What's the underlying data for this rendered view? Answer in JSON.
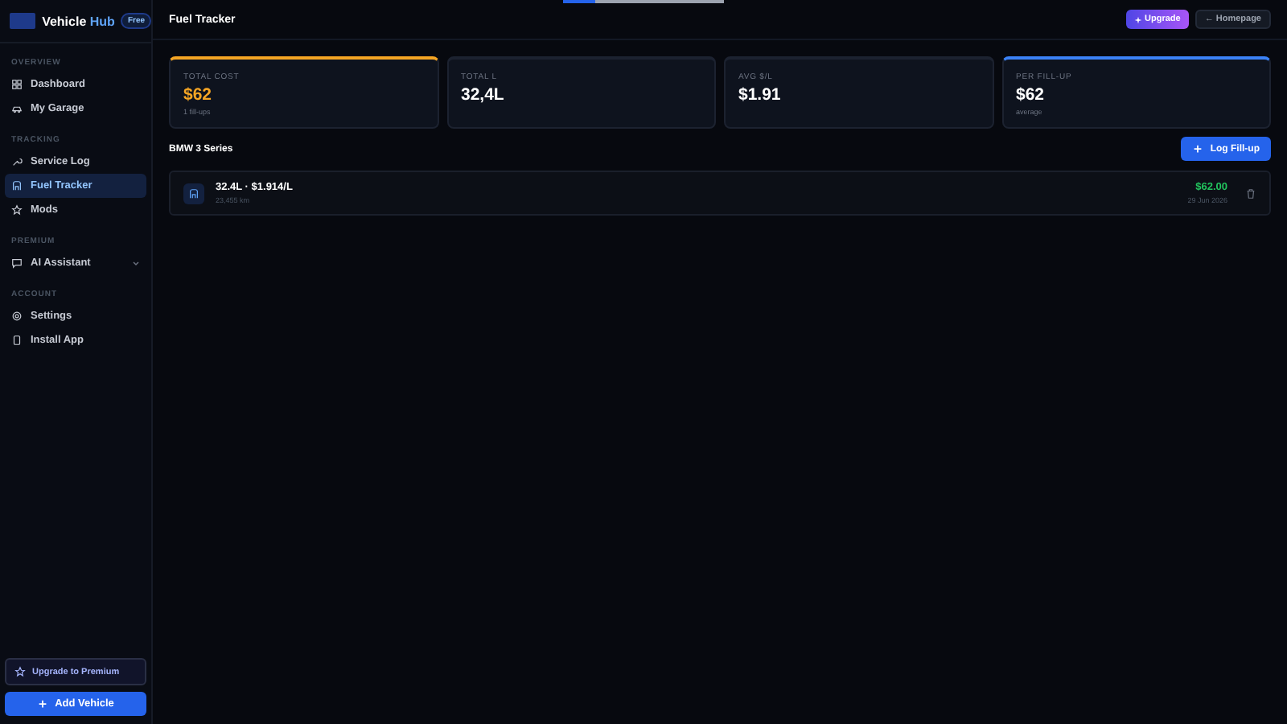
{
  "loading_bar": {
    "level": 0.2
  },
  "sidebar": {
    "brand": {
      "name": "Vehicle",
      "accent": "Hub",
      "badge": "Free"
    },
    "sections": [
      {
        "title": "OVERVIEW",
        "items": [
          {
            "label": "Dashboard",
            "selected": false
          },
          {
            "label": "My Garage",
            "selected": false
          }
        ]
      },
      {
        "title": "TRACKING",
        "items": [
          {
            "label": "Service Log",
            "selected": false
          },
          {
            "label": "Fuel Tracker",
            "selected": true
          },
          {
            "label": "Mods",
            "selected": false
          }
        ]
      },
      {
        "title": "PREMIUM",
        "items": [
          {
            "label": "AI Assistant",
            "selected": false,
            "expandable": true
          }
        ]
      },
      {
        "title": "ACCOUNT",
        "items": [
          {
            "label": "Settings",
            "selected": false
          },
          {
            "label": "Install App",
            "selected": false
          }
        ]
      }
    ],
    "upgrade_button": "Upgrade to Premium",
    "add_button": "Add Vehicle"
  },
  "header": {
    "title": "Fuel Tracker",
    "upgrade_button": "Upgrade",
    "home_button": "← Homepage"
  },
  "stats": [
    {
      "label": "TOTAL COST",
      "value": "$62",
      "note": "1 fill-ups",
      "color": "#f5a524"
    },
    {
      "label": "TOTAL L",
      "value": "32,4L"
    },
    {
      "label": "AVG $/L",
      "value": "$1.91"
    },
    {
      "label": "PER FILL-UP",
      "value": "$62",
      "note": "average",
      "color": "#3b82f6"
    }
  ],
  "vehicle": {
    "name": "BMW 3 Series",
    "log_button": "Log Fill-up"
  },
  "entries": [
    {
      "title": "32.4L · $1.914/L",
      "odometer": "23,455 km",
      "cost": "$62.00",
      "date": "29 Jun 2026"
    }
  ]
}
